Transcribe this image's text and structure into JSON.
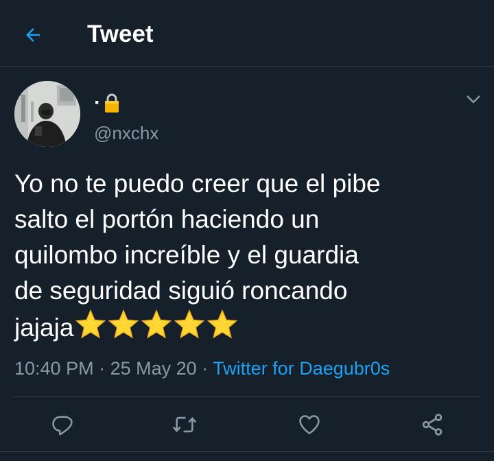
{
  "header": {
    "title": "Tweet",
    "back_icon": "arrow-left-icon",
    "accent": "#1da1f2"
  },
  "tweet": {
    "display_name_text": "·",
    "display_name_icon": "lock-icon",
    "handle": "@nxchx",
    "text": "Yo no te puedo creer que el pibe\nsalto el portón haciendo un\nquilombo increíble y el guardia\nde seguridad siguió roncando\njajaja",
    "emoji": [
      "star-emoji",
      "star-emoji",
      "star-emoji",
      "star-emoji",
      "star-emoji"
    ],
    "time": "10:40 PM",
    "separator": " · ",
    "date": "25 May 20",
    "separator2": " · ",
    "source": "Twitter for Daegubr0s"
  },
  "actions": [
    "reply-icon",
    "retweet-icon",
    "like-icon",
    "share-icon"
  ],
  "colors": {
    "background": "#15202b",
    "divider": "#38444d",
    "secondary_text": "#8899a6",
    "link": "#1da1f2"
  }
}
